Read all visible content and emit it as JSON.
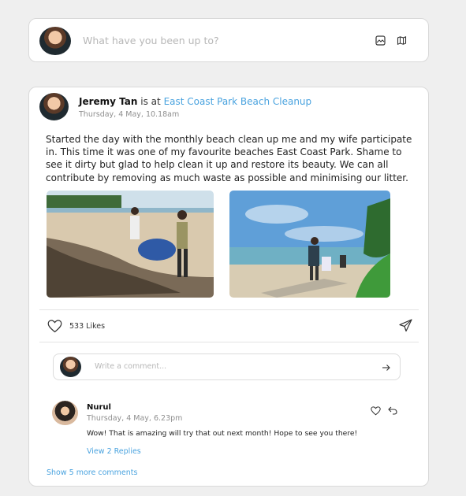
{
  "composer": {
    "placeholder": "What have you been up to?",
    "icons": [
      "image-icon",
      "map-icon"
    ]
  },
  "post": {
    "author": "Jeremy Tan",
    "connector": "is at",
    "location": "East Coast Park Beach Cleanup",
    "timestamp": "Thursday, 4 May, 10.18am",
    "body": "Started the day with the monthly beach clean up me and my wife participate in. This time it was one of my favourite beaches East Coast Park. Shame to see it dirty but glad to help clean it up and restore its beauty. We can all contribute by removing as much waste as possible and minimising our litter.",
    "likes": "533 Likes"
  },
  "comment_input": {
    "placeholder": "Write a comment..."
  },
  "comment": {
    "author": "Nurul",
    "timestamp": "Thursday, 4 May, 6.23pm",
    "text": "Wow! That is amazing will try that out next month! Hope to see you there!",
    "replies_link": "View 2 Replies"
  },
  "more_comments": "Show 5 more comments",
  "colors": {
    "accent": "#4aa3df",
    "background": "#efefef",
    "card": "#ffffff"
  }
}
